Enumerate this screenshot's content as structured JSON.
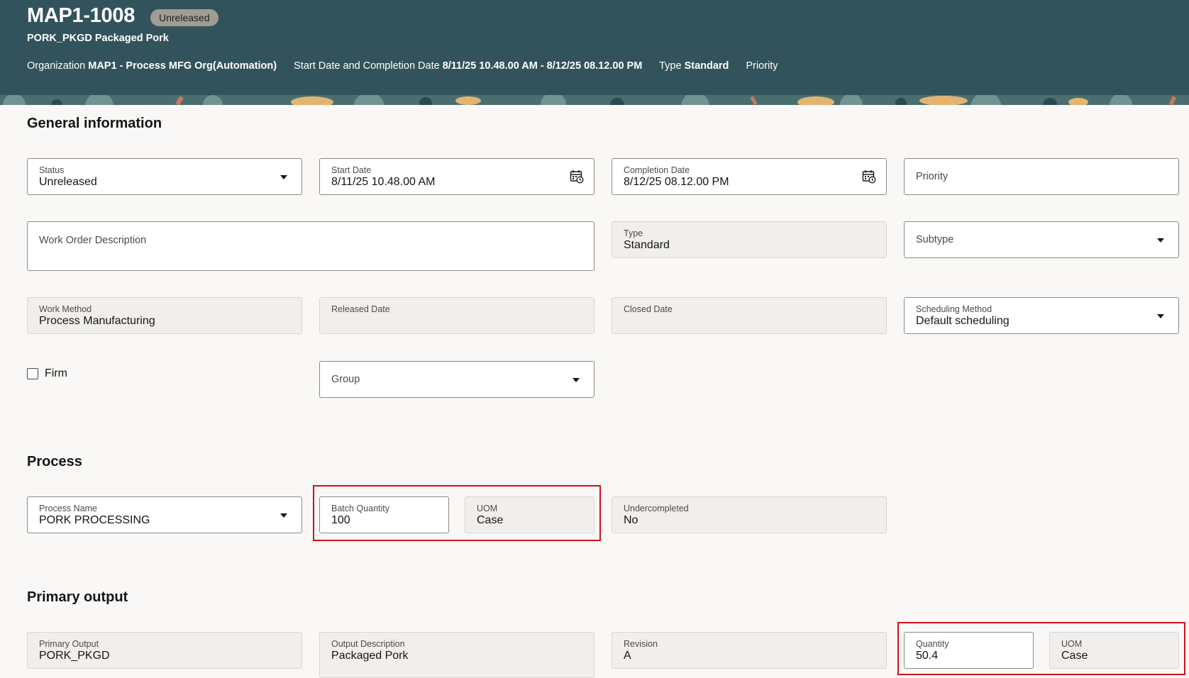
{
  "header": {
    "title": "MAP1-1008",
    "badge": "Unreleased",
    "subtitle": "PORK_PKGD Packaged Pork",
    "meta": {
      "org_label": "Organization",
      "org_value": "MAP1 - Process MFG Org(Automation)",
      "dates_label": "Start Date and Completion Date",
      "dates_value": "8/11/25 10.48.00 AM - 8/12/25 08.12.00 PM",
      "type_label": "Type",
      "type_value": "Standard",
      "priority_label": "Priority"
    }
  },
  "general": {
    "title": "General information",
    "status": {
      "label": "Status",
      "value": "Unreleased"
    },
    "start_date": {
      "label": "Start Date",
      "value": "8/11/25 10.48.00 AM"
    },
    "completion_date": {
      "label": "Completion Date",
      "value": "8/12/25 08.12.00 PM"
    },
    "priority": {
      "placeholder": "Priority"
    },
    "description": {
      "placeholder": "Work Order Description"
    },
    "type": {
      "label": "Type",
      "value": "Standard"
    },
    "subtype": {
      "placeholder": "Subtype"
    },
    "work_method": {
      "label": "Work Method",
      "value": "Process Manufacturing"
    },
    "released_date": {
      "label": "Released Date",
      "value": ""
    },
    "closed_date": {
      "label": "Closed Date",
      "value": ""
    },
    "scheduling_method": {
      "label": "Scheduling Method",
      "value": "Default scheduling"
    },
    "firm": {
      "label": "Firm",
      "checked": false
    },
    "group": {
      "placeholder": "Group"
    }
  },
  "process": {
    "title": "Process",
    "process_name": {
      "label": "Process Name",
      "value": "PORK PROCESSING"
    },
    "batch_quantity": {
      "label": "Batch Quantity",
      "value": "100"
    },
    "uom": {
      "label": "UOM",
      "value": "Case"
    },
    "undercompleted": {
      "label": "Undercompleted",
      "value": "No"
    }
  },
  "primary_output": {
    "title": "Primary output",
    "primary_output": {
      "label": "Primary Output",
      "value": "PORK_PKGD"
    },
    "output_description": {
      "label": "Output Description",
      "value": "Packaged Pork"
    },
    "revision": {
      "label": "Revision",
      "value": "A"
    },
    "quantity": {
      "label": "Quantity",
      "value": "50.4"
    },
    "uom": {
      "label": "UOM",
      "value": "Case"
    }
  },
  "colors": {
    "header_bg": "#32535b",
    "highlight": "#d0101c",
    "page_bg": "#f9f8f6"
  }
}
